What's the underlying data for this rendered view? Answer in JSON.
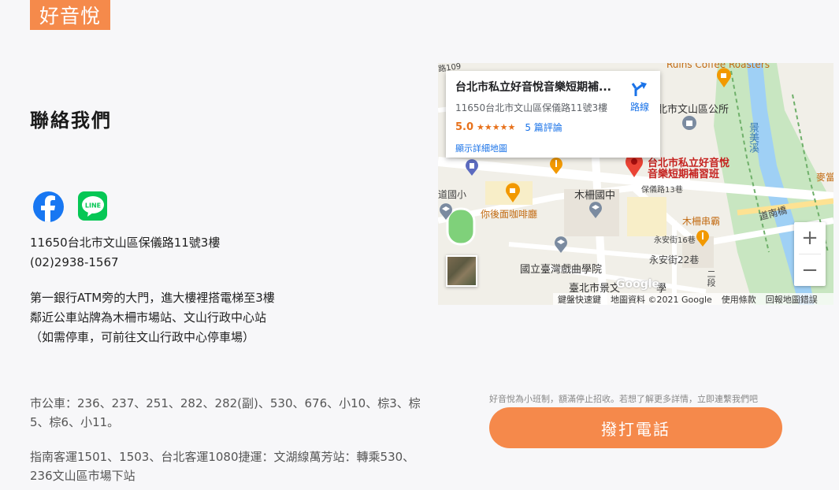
{
  "header": {
    "logo_text": "好音悅"
  },
  "page": {
    "title": "聯絡我們"
  },
  "social": {
    "facebook_icon": "facebook-icon",
    "line_icon": "line-icon",
    "line_label": "LINE"
  },
  "contact": {
    "address": "11650台北市文山區保儀路11號3樓",
    "phone": "(02)2938-1567"
  },
  "directions": [
    "第一銀行ATM旁的大門，進大樓裡搭電梯至3樓",
    "鄰近公車站牌為木柵市場站、文山行政中心站",
    "（如需停車，可前往文山行政中心停車場）"
  ],
  "transit": {
    "bus": "市公車：236、237、251、282、282(副)、530、676、小10、棕3、棕5、棕6、小11。",
    "coach": "指南客運1501、1503、台北客運1080捷運：文湖線萬芳站：轉乘530、236文山區市場下站"
  },
  "map": {
    "card": {
      "title": "台北市私立好音悅音樂短期補...",
      "address": "11650台北市文山區保儀路11號3樓",
      "rating": "5.0",
      "stars": "★★★★★",
      "reviews": "5 篇評論",
      "link": "顯示詳細地圖",
      "directions_label": "路線"
    },
    "labels": {
      "roasters": "Ruins Coffee Roasters",
      "district_office": "北市文山區公所",
      "pin_name_1": "台北市私立好音悅",
      "pin_name_2": "音樂短期補習班",
      "river": "景美溪",
      "muzha_school": "木柵國中",
      "cafe": "你後面咖啡廳",
      "restaurant": "木柵串霸",
      "lane22": "永安街22巷",
      "lane16": "永安街16巷",
      "baoyi13": "保儀路13巷",
      "opera_school": "國立臺灣戲曲學院",
      "bridge": "道南橋",
      "road109": "路109",
      "elem": "道國小",
      "mc": "麥當",
      "school_bottom": "臺北市景文",
      "duan": "二段",
      "xue": "學"
    },
    "google_logo": "Google",
    "attribution": [
      "鍵盤快速鍵",
      "地圖資料 ©2021 Google",
      "使用條款",
      "回報地圖錯誤"
    ],
    "zoom_in": "+",
    "zoom_out": "−"
  },
  "cta": {
    "note": "好音悅為小班制，額滿停止招收。若想了解更多詳情，立即連繫我們吧",
    "call_label": "撥打電話"
  },
  "colors": {
    "brand": "#f5894b",
    "facebook": "#1877f2",
    "line": "#06c755"
  }
}
